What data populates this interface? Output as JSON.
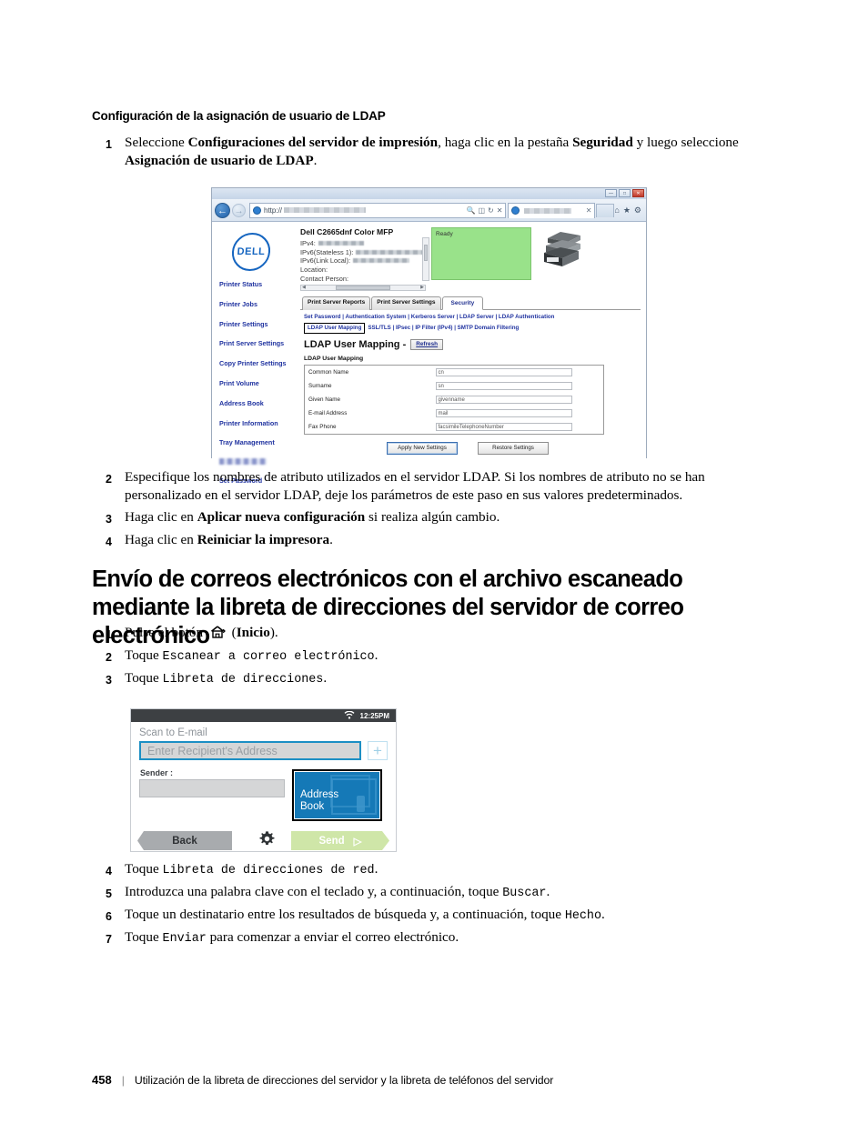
{
  "section": {
    "heading": "Configuración de la asignación de usuario de LDAP",
    "step1": {
      "num": "1",
      "pre": "Seleccione ",
      "b1": "Configuraciones del servidor de impresión",
      "mid": ", haga clic en la pestaña ",
      "b2": "Seguridad",
      "mid2": " y luego seleccione ",
      "b3": "Asignación de usuario de LDAP",
      "end": "."
    },
    "step2": {
      "num": "2",
      "text": "Especifique los nombres de atributo utilizados en el servidor LDAP. Si los nombres de atributo no se han personalizado en el servidor LDAP, deje los parámetros de este paso en sus valores predeterminados."
    },
    "step3": {
      "num": "3",
      "pre": "Haga clic en ",
      "b1": "Aplicar nueva configuración",
      "end": " si realiza algún cambio."
    },
    "step4": {
      "num": "4",
      "pre": "Haga clic en ",
      "b1": "Reiniciar la impresora",
      "end": "."
    }
  },
  "browser": {
    "window_controls": [
      "minimize-button",
      "maximize-button",
      "close-button"
    ],
    "url_prefix": "http://",
    "url_redacted": true,
    "tab_title_redacted": true,
    "nav_icons": [
      "back-arrow",
      "forward-arrow",
      "search-icon",
      "compat-icon",
      "refresh-icon",
      "stop-icon"
    ],
    "right_icons": [
      "home-icon",
      "favorites-icon",
      "tools-icon"
    ],
    "brand": "DELL",
    "sidebar": [
      "Printer Status",
      "Printer Jobs",
      "Printer Settings",
      "Print Server Settings",
      "Copy Printer Settings",
      "Print Volume",
      "Address Book",
      "Printer Information",
      "Tray Management",
      "",
      "Set Password"
    ],
    "printer": {
      "model": "Dell C2665dnf Color MFP",
      "fields": [
        {
          "label": "IPv4:",
          "value_redacted": true
        },
        {
          "label": "IPv6(Stateless 1):",
          "value_redacted": true
        },
        {
          "label": "IPv6(Link Local):",
          "value_redacted": true
        },
        {
          "label": "Location:",
          "value_redacted": false
        },
        {
          "label": "Contact Person:",
          "value_redacted": false
        }
      ],
      "status": "Ready"
    },
    "tabs": [
      {
        "label": "Print Server Reports",
        "active": false
      },
      {
        "label": "Print Server Settings",
        "active": false
      },
      {
        "label": "Security",
        "active": true
      }
    ],
    "link_row_1": "Set Password | Authentication System | Kerberos Server | LDAP Server | LDAP Authentication",
    "link_row_2_selected": "LDAP User Mapping",
    "link_row_2_rest": "SSL/TLS | IPsec | IP Filter (IPv4) | SMTP Domain Filtering",
    "page_heading": "LDAP User Mapping -",
    "refresh_label": "Refresh",
    "table_heading": "LDAP User Mapping",
    "table_rows": [
      {
        "label": "Common Name",
        "value": "cn"
      },
      {
        "label": "Surname",
        "value": "sn"
      },
      {
        "label": "Given Name",
        "value": "givenname"
      },
      {
        "label": "E-mail Address",
        "value": "mail"
      },
      {
        "label": "Fax Phone",
        "value": "facsimileTelephoneNumber"
      }
    ],
    "apply_label": "Apply New Settings",
    "restore_label": "Restore Settings"
  },
  "bigheading": "Envío de correos electrónicos con el archivo escaneado mediante la libreta de direcciones del servidor de correo electrónico",
  "steps2": {
    "s1": {
      "num": "1",
      "pre": "Pulse el botón ",
      "icon": "home-icon",
      "post_open": " (",
      "b": "Inicio",
      "post_close": ")."
    },
    "s2": {
      "num": "2",
      "pre": "Toque ",
      "mono": "Escanear a correo electrónico",
      "end": "."
    },
    "s3": {
      "num": "3",
      "pre": "Toque ",
      "mono": "Libreta de direcciones",
      "end": "."
    },
    "s4": {
      "num": "4",
      "pre": "Toque ",
      "mono": "Libreta de direcciones de red",
      "end": "."
    },
    "s5": {
      "num": "5",
      "pre": "Introduzca una palabra clave con el teclado y, a continuación, toque ",
      "mono": "Buscar",
      "end": "."
    },
    "s6": {
      "num": "6",
      "pre": "Toque un destinatario entre los resultados de búsqueda y, a continuación, toque ",
      "mono": "Hecho",
      "end": "."
    },
    "s7": {
      "num": "7",
      "pre": "Toque ",
      "mono": "Enviar",
      "end": " para comenzar a enviar el correo electrónico."
    }
  },
  "panel": {
    "time": "12:25PM",
    "wifi_icon": "wifi-icon",
    "title": "Scan to E-mail",
    "recipient_placeholder": "Enter Recipient's Address",
    "add_label": "+",
    "sender_label": "Sender :",
    "sender_value": "",
    "address_book_line1": "Address",
    "address_book_line2": "Book",
    "back_label": "Back",
    "gear_icon": "gear-icon",
    "send_label": "Send",
    "send_arrow": "▷"
  },
  "footer": {
    "page_number": "458",
    "separator": "|",
    "text": "Utilización de la libreta de direcciones del servidor y la libreta de teléfonos del servidor"
  },
  "colors": {
    "dell_blue": "#1565c0",
    "link_blue": "#2033a0",
    "status_green": "#99e28a",
    "panel_accent": "#1c8fc4",
    "address_book_blue": "#1579b7",
    "send_green": "#cfe6a8"
  }
}
